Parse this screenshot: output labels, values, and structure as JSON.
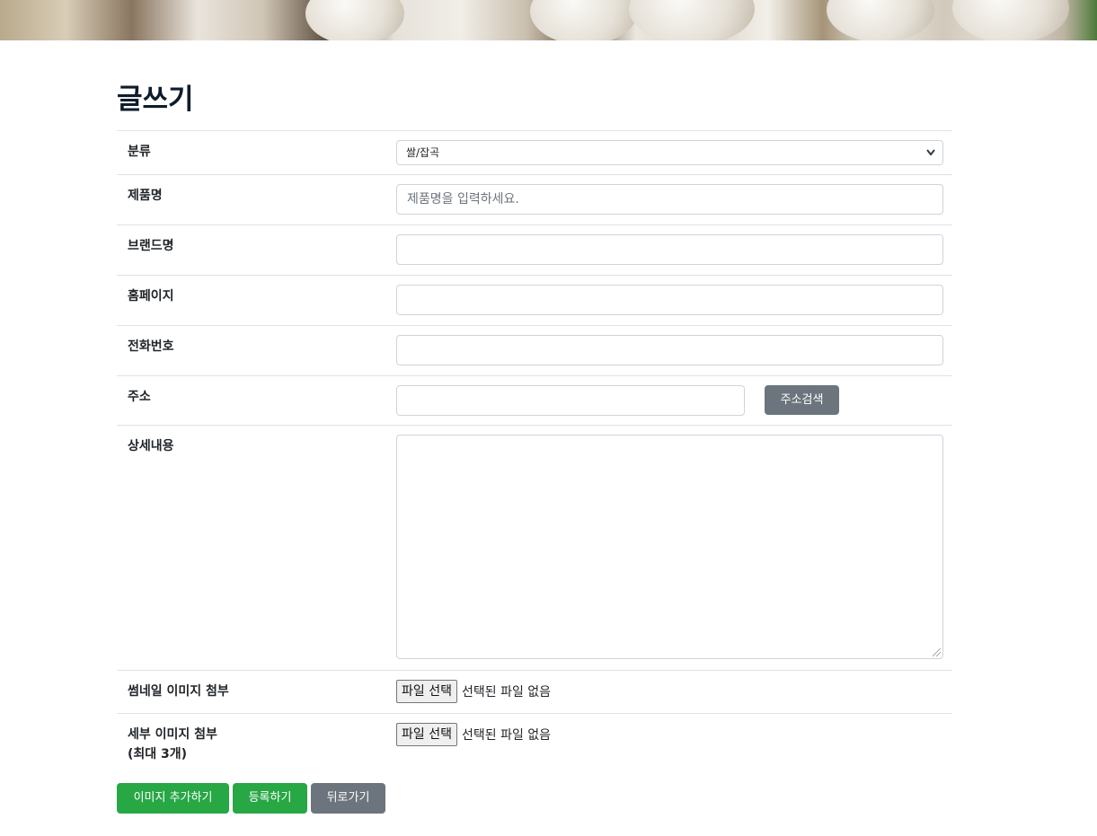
{
  "page": {
    "title": "글쓰기"
  },
  "form": {
    "category": {
      "label": "분류",
      "value": "쌀/잡곡"
    },
    "product_name": {
      "label": "제품명",
      "placeholder": "제품명을 입력하세요."
    },
    "brand_name": {
      "label": "브랜드명",
      "value": ""
    },
    "homepage": {
      "label": "홈페이지",
      "value": ""
    },
    "phone": {
      "label": "전화번호",
      "value": ""
    },
    "address": {
      "label": "주소",
      "value": "",
      "search_button": "주소검색"
    },
    "detail": {
      "label": "상세내용",
      "value": ""
    },
    "thumbnail": {
      "label": "썸네일 이미지 첨부",
      "button": "파일 선택",
      "status": "선택된 파일 없음"
    },
    "detail_images": {
      "label_line1": "세부 이미지 첨부",
      "label_line2": "(최대 3개)",
      "button": "파일 선택",
      "status": "선택된 파일 없음"
    }
  },
  "actions": {
    "add_image": "이미지 추가하기",
    "submit": "등록하기",
    "back": "뒤로가기"
  },
  "icons": {
    "select_chevron": "chevron-down-icon"
  },
  "colors": {
    "green": "#28a745",
    "gray": "#6c757d",
    "title": "#0f1c2b"
  }
}
